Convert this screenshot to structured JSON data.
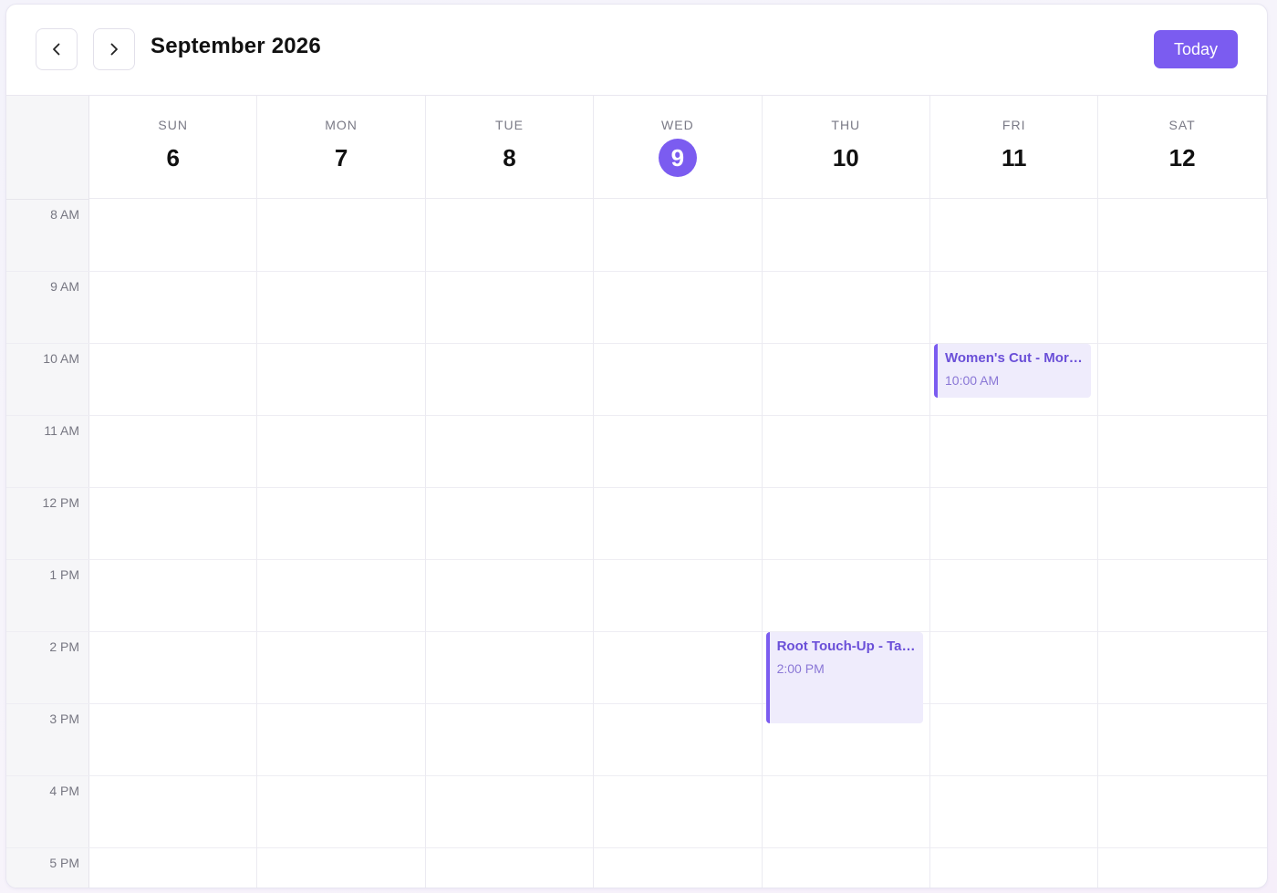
{
  "header": {
    "title": "September 2026",
    "today_label": "Today",
    "prev_icon": "chevron-left-icon",
    "next_icon": "chevron-right-icon"
  },
  "colors": {
    "accent": "#7b5cf0",
    "event_bg": "#efecfc",
    "event_text": "#6a4fd8"
  },
  "days": [
    {
      "name": "SUN",
      "num": "6",
      "today": false
    },
    {
      "name": "MON",
      "num": "7",
      "today": false
    },
    {
      "name": "TUE",
      "num": "8",
      "today": false
    },
    {
      "name": "WED",
      "num": "9",
      "today": true
    },
    {
      "name": "THU",
      "num": "10",
      "today": false
    },
    {
      "name": "FRI",
      "num": "11",
      "today": false
    },
    {
      "name": "SAT",
      "num": "12",
      "today": false
    }
  ],
  "hours": [
    "8 AM",
    "9 AM",
    "10 AM",
    "11 AM",
    "12 PM",
    "1 PM",
    "2 PM",
    "3 PM",
    "4 PM",
    "5 PM"
  ],
  "events": [
    {
      "title": "Women's Cut - Morgan",
      "time": "10:00 AM",
      "day": "FRI"
    },
    {
      "title": "Root Touch-Up - Taylor",
      "time": "2:00 PM",
      "day": "THU"
    }
  ]
}
